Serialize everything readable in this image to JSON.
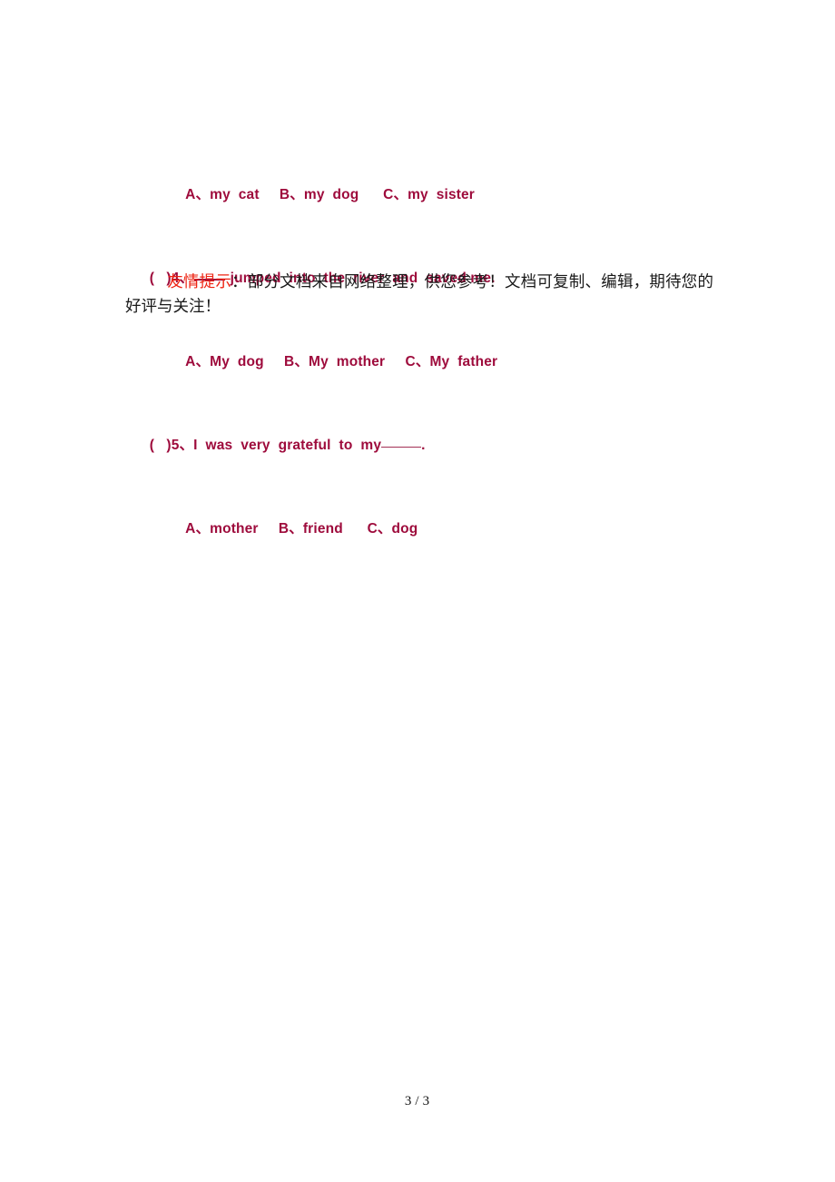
{
  "document": {
    "type": "worksheet-page",
    "colors": {
      "quiz_text": "#9e0b3c",
      "note_highlight": "#ee2211",
      "note_text": "#1a1a1a",
      "background": "#ffffff"
    }
  },
  "quiz": {
    "lines": [
      {
        "id": "q3-options",
        "indent": true,
        "text": "A、my  cat     B、my  dog      C、my  sister"
      },
      {
        "id": "q4-stem",
        "indent": false,
        "text_before": "(   )4、",
        "blank": "bold",
        "text_after": " jumped  into  the  river  and  saved me."
      },
      {
        "id": "q4-options",
        "indent": true,
        "text": "A、My  dog     B、My  mother     C、My  father"
      },
      {
        "id": "q5-stem",
        "indent": false,
        "text_before": "(   )5、I  was  very  grateful  to  my",
        "blank": "thin",
        "text_after": "."
      },
      {
        "id": "q5-options",
        "indent": true,
        "text": "A、mother     B、friend      C、dog"
      }
    ]
  },
  "note": {
    "highlight": "友情提示",
    "body": "：部分文档来自网络整理，供您参考！文档可复制、编辑，期待您的好评与关注！"
  },
  "footer": {
    "current_page": "3",
    "separator": "/",
    "total_pages": "3"
  }
}
